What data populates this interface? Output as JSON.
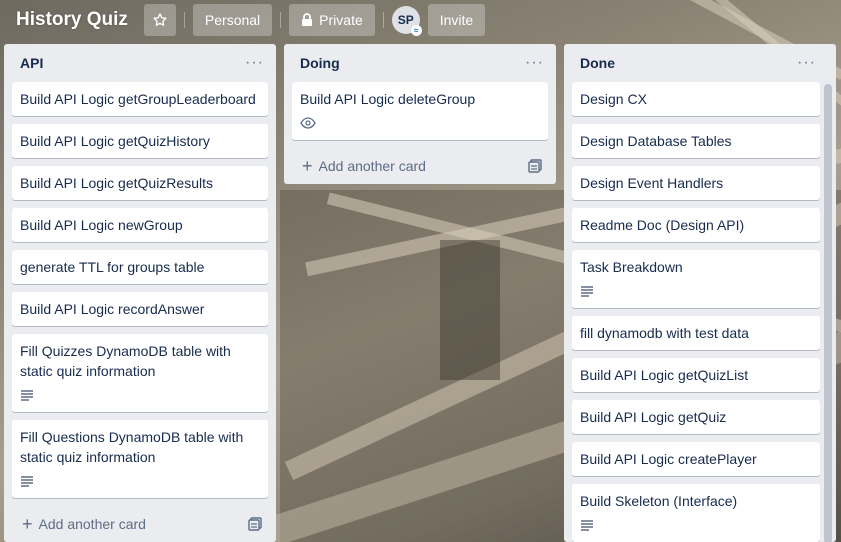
{
  "header": {
    "board_title": "History Quiz",
    "visibility_team": "Personal",
    "visibility_private": "Private",
    "avatar_initials": "SP",
    "invite_label": "Invite"
  },
  "lists": [
    {
      "title": "API",
      "cards": [
        {
          "text": "Build API Logic getGroupLeaderboard"
        },
        {
          "text": "Build API Logic getQuizHistory"
        },
        {
          "text": "Build API Logic getQuizResults"
        },
        {
          "text": "Build API Logic newGroup"
        },
        {
          "text": "generate TTL for groups table"
        },
        {
          "text": "Build API Logic recordAnswer"
        },
        {
          "text": "Fill Quizzes DynamoDB table with static quiz information",
          "has_description": true
        },
        {
          "text": "Fill Questions DynamoDB table with static quiz information",
          "has_description": true
        }
      ],
      "add_card_label": "Add another card"
    },
    {
      "title": "Doing",
      "cards": [
        {
          "text": "Build API Logic deleteGroup",
          "watching": true
        }
      ],
      "add_card_label": "Add another card"
    },
    {
      "title": "Done",
      "cards": [
        {
          "text": "Design CX"
        },
        {
          "text": "Design Database Tables"
        },
        {
          "text": "Design Event Handlers"
        },
        {
          "text": "Readme Doc (Design API)"
        },
        {
          "text": "Task Breakdown",
          "has_description": true
        },
        {
          "text": "fill dynamodb with test data"
        },
        {
          "text": "Build API Logic getQuizList"
        },
        {
          "text": "Build API Logic getQuiz"
        },
        {
          "text": "Build API Logic createPlayer"
        },
        {
          "text": "Build Skeleton (Interface)",
          "has_description": true
        }
      ]
    }
  ]
}
